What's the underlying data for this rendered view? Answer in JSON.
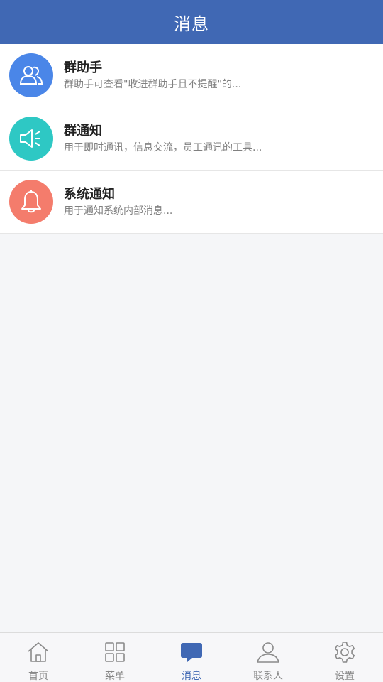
{
  "header": {
    "title": "消息"
  },
  "messages": [
    {
      "title": "群助手",
      "desc": "群助手可查看\"收进群助手且不提醒\"的...",
      "icon": "group-icon",
      "color": "#4a86e8"
    },
    {
      "title": "群通知",
      "desc": "用于即时通讯，信息交流，员工通讯的工具...",
      "icon": "speaker-icon",
      "color": "#2ec8c4"
    },
    {
      "title": "系统通知",
      "desc": "用于通知系统内部消息...",
      "icon": "bell-icon",
      "color": "#f47c6c"
    }
  ],
  "tabbar": {
    "tabs": [
      {
        "label": "首页",
        "icon": "home-icon"
      },
      {
        "label": "菜单",
        "icon": "grid-icon"
      },
      {
        "label": "消息",
        "icon": "chat-icon",
        "active": true
      },
      {
        "label": "联系人",
        "icon": "person-icon"
      },
      {
        "label": "设置",
        "icon": "gear-icon"
      }
    ]
  },
  "colors": {
    "header": "#4068b4",
    "active_tab": "#4068b4",
    "inactive_tab": "#888888"
  }
}
